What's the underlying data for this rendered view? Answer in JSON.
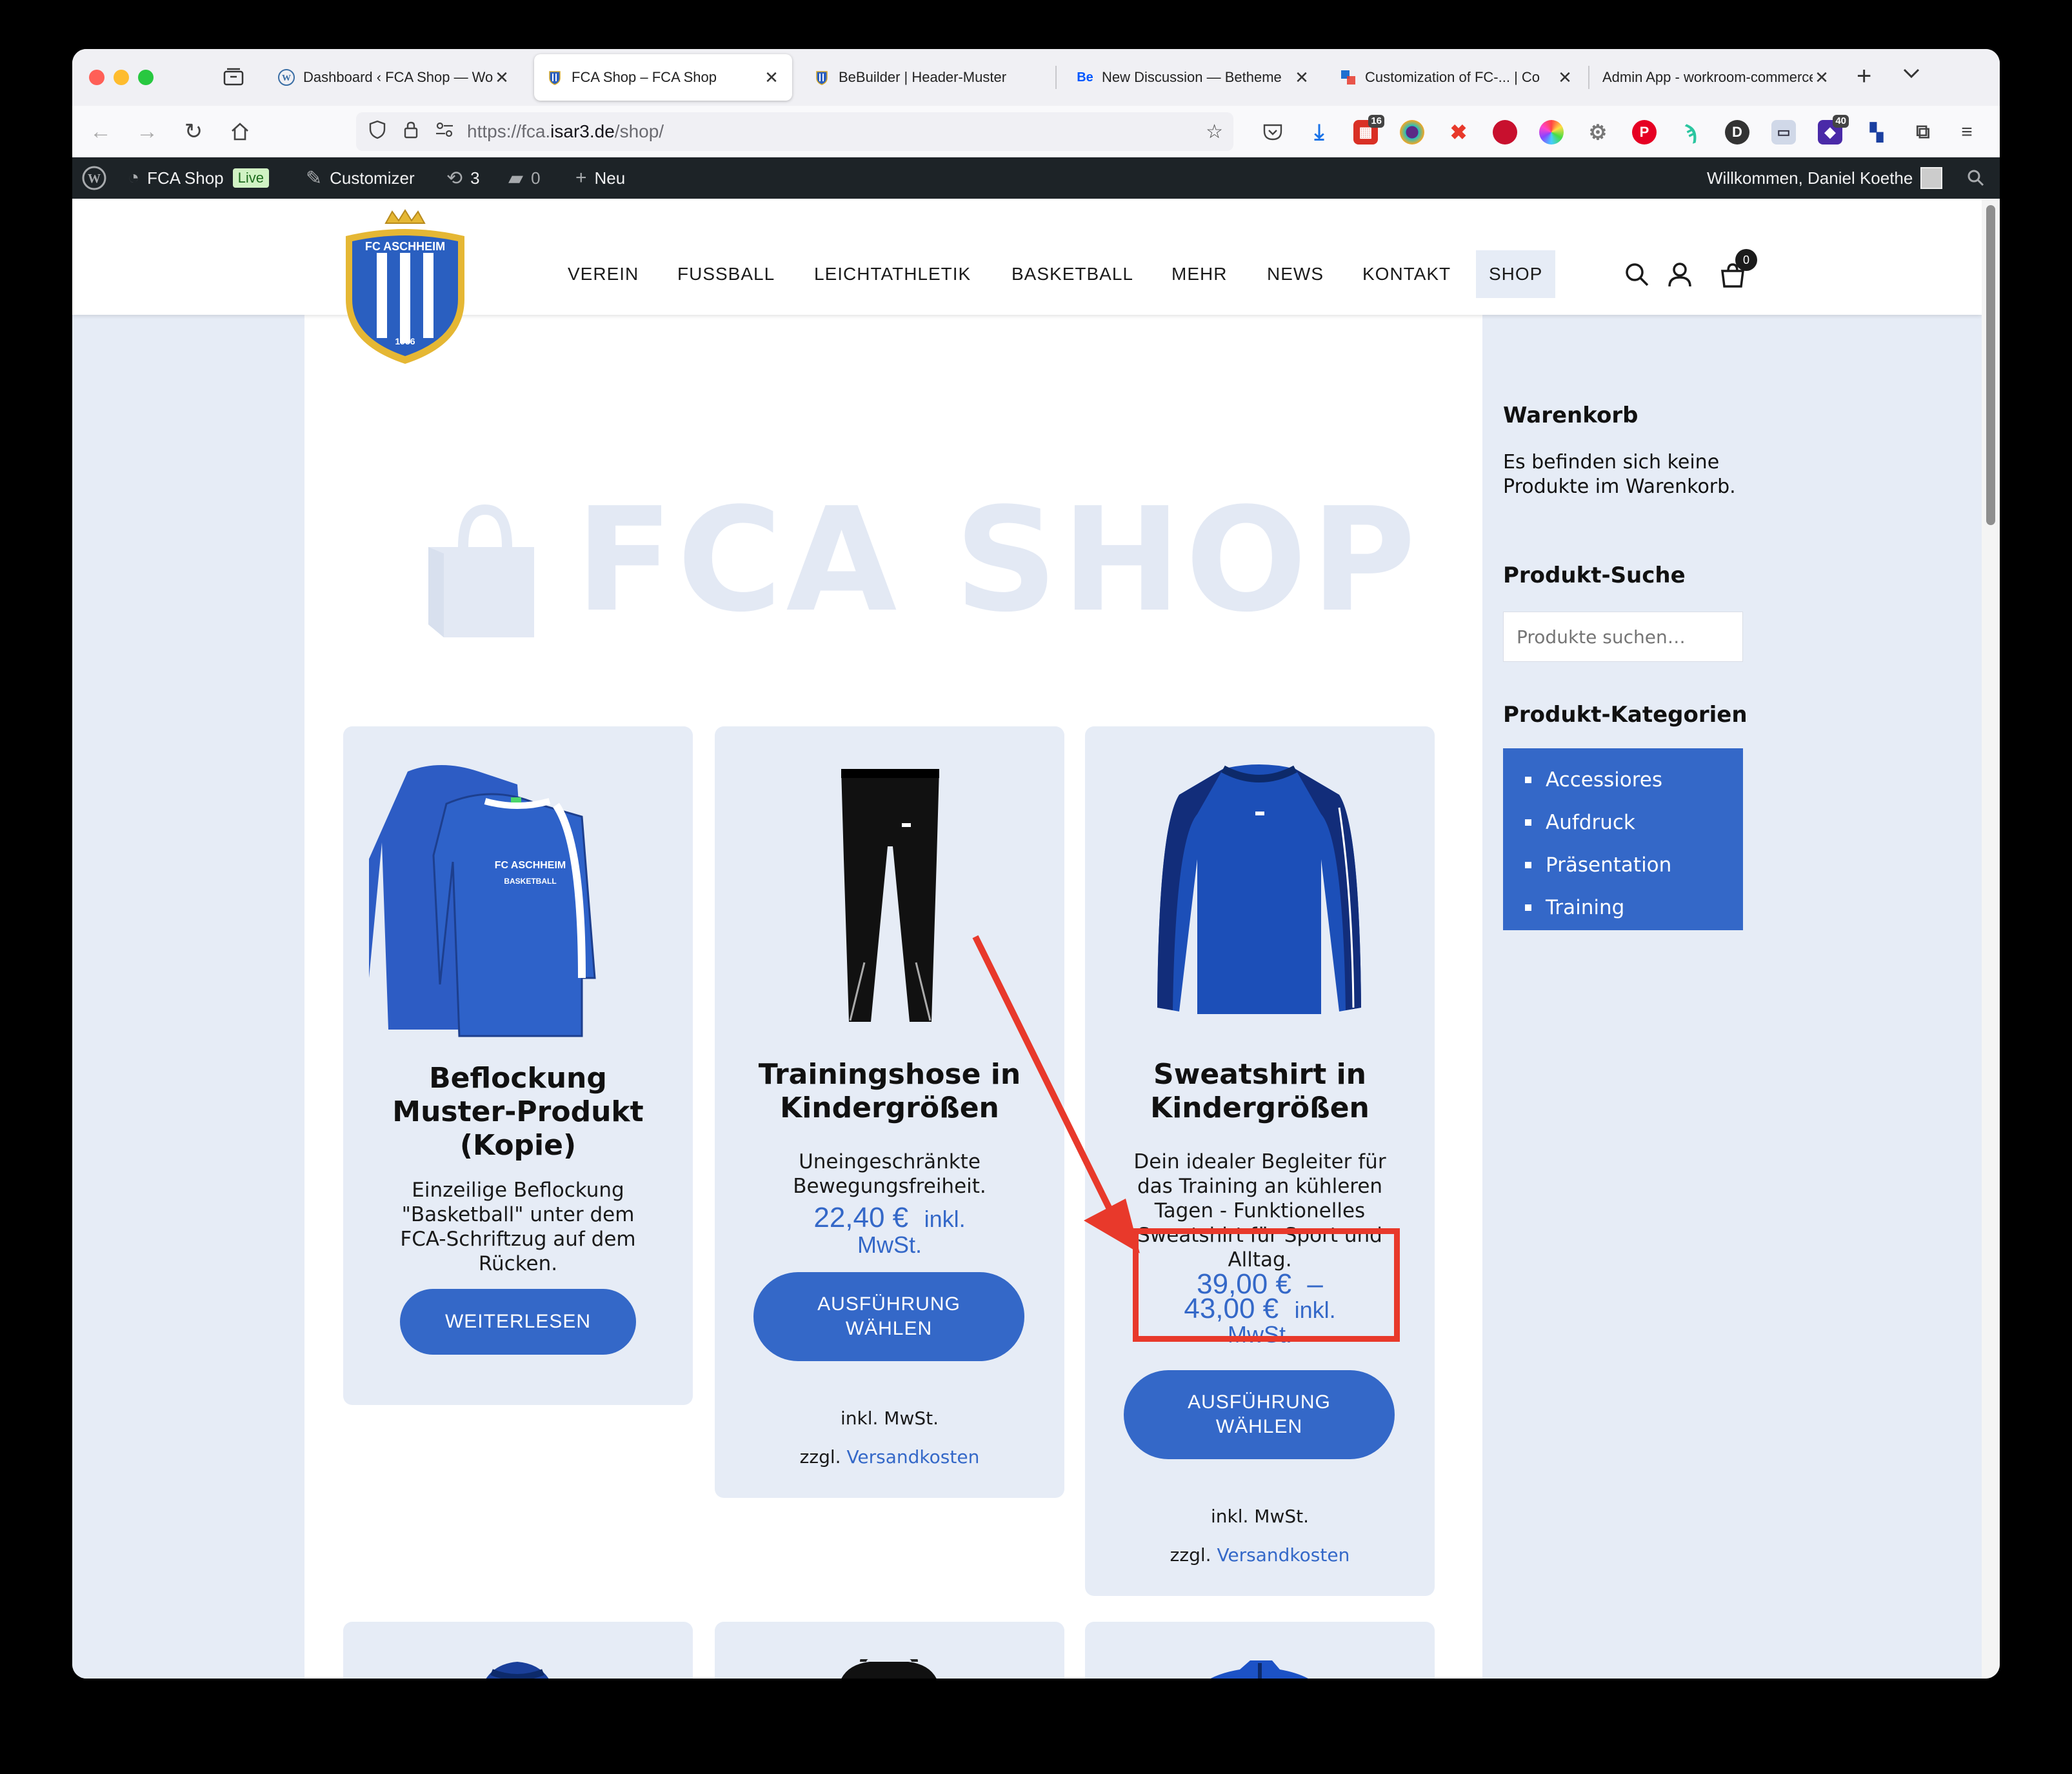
{
  "browser": {
    "tabs": [
      {
        "label": "Dashboard ‹ FCA Shop — Wo",
        "favicon": "wordpress-icon"
      },
      {
        "label": "FCA Shop – FCA Shop",
        "favicon": "fca-crest-icon",
        "active": true
      },
      {
        "label": "BeBuilder | Header-Muster",
        "favicon": "fca-crest-icon"
      },
      {
        "label": "New Discussion — Betheme",
        "favicon": "behance-icon",
        "favicon_text": "Be"
      },
      {
        "label": "Customization of FC-... | Co",
        "favicon": "squares-icon"
      },
      {
        "label": "Admin App - workroom-commerce",
        "favicon": "none"
      }
    ],
    "url_prefix": "https://fca.",
    "url_domain": "isar3.de",
    "url_path": "/shop/",
    "ext_badges": {
      "calendar": "16",
      "shield": "40"
    }
  },
  "adminbar": {
    "site": "FCA Shop",
    "live": "Live",
    "customizer": "Customizer",
    "updates": "3",
    "comments": "0",
    "new": "Neu",
    "welcome": "Willkommen, Daniel Koethe"
  },
  "header": {
    "menu": [
      "VEREIN",
      "FUSSBALL",
      "LEICHTATHLETIK",
      "BASKETBALL",
      "MEHR",
      "NEWS",
      "KONTAKT",
      "SHOP"
    ],
    "active_menu": "SHOP",
    "cart_count": "0",
    "logo_text": "FC ASCHHEIM",
    "logo_year": "1956"
  },
  "hero": {
    "title": "FCA SHOP"
  },
  "products": [
    {
      "title_lines": [
        "Beflockung",
        "Muster-Produkt",
        "(Kopie)"
      ],
      "desc_lines": [
        "Einzeilige Beflockung",
        "\"Basketball\" unter dem",
        "FCA-Schriftzug auf dem",
        "Rücken."
      ],
      "button": "WEITERLESEN",
      "image_text_1": "FC ASCHHEIM",
      "image_text_2": "BASKETBALL"
    },
    {
      "title_lines": [
        "Trainingshose in",
        "Kindergrößen"
      ],
      "desc_lines": [
        "Uneingeschränkte",
        "Bewegungsfreiheit."
      ],
      "price": "22,40 €",
      "tax_1": "inkl.",
      "tax_2": "MwSt.",
      "button_1": "AUSFÜHRUNG",
      "button_2": "WÄHLEN",
      "note_incl": "inkl. MwSt.",
      "note_zzgl": "zzgl.",
      "note_link": "Versandkosten"
    },
    {
      "title_lines": [
        "Sweatshirt in",
        "Kindergrößen"
      ],
      "desc_lines": [
        "Dein idealer Begleiter für",
        "das Training an kühleren",
        "Tagen - Funktionelles",
        "Sweatshirt für Sport und",
        "Alltag."
      ],
      "price_from": "39,00 €",
      "price_sep": "–",
      "price_to": "43,00 €",
      "tax_1": "inkl.",
      "tax_2": "MwSt.",
      "button_1": "AUSFÜHRUNG",
      "button_2": "WÄHLEN",
      "note_incl": "inkl. MwSt.",
      "note_zzgl": "zzgl.",
      "note_link": "Versandkosten"
    }
  ],
  "sidebar": {
    "cart_heading": "Warenkorb",
    "cart_empty": "Es befinden sich keine Produkte im Warenkorb.",
    "search_heading": "Produkt-Suche",
    "search_placeholder": "Produkte suchen…",
    "categories_heading": "Produkt-Kategorien",
    "categories": [
      "Accessiores",
      "Aufdruck",
      "Präsentation",
      "Training"
    ]
  },
  "colors": {
    "accent": "#3468c8",
    "page_bg": "#e6ecf6",
    "annotation": "#e8392b",
    "adminbar": "#1d2327"
  }
}
